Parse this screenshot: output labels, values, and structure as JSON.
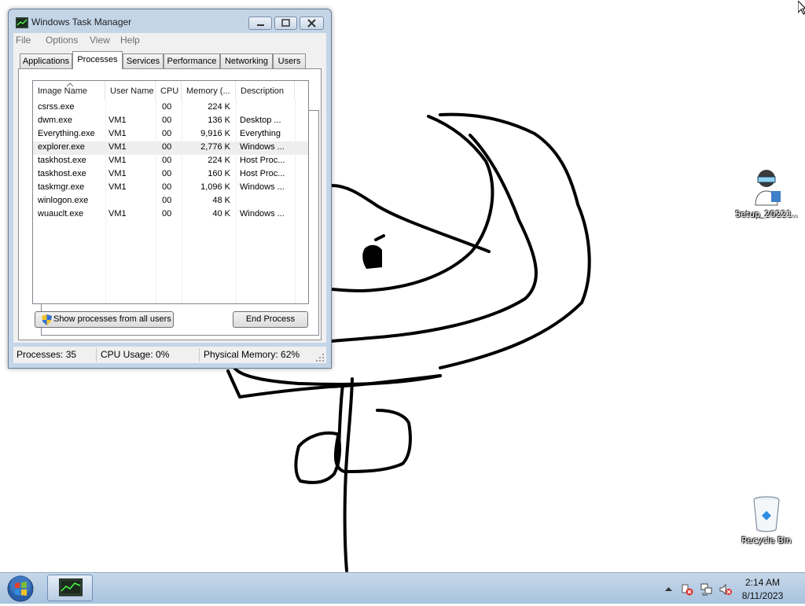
{
  "desktop": {
    "icons": [
      {
        "label": "Setup_20221..."
      },
      {
        "label": "Recycle Bin"
      }
    ]
  },
  "window": {
    "title": "Windows Task Manager",
    "menu": [
      "File",
      "Options",
      "View",
      "Help"
    ],
    "tabs": [
      "Applications",
      "Processes",
      "Services",
      "Performance",
      "Networking",
      "Users"
    ],
    "active_tab": "Processes",
    "columns": [
      "Image Name",
      "User Name",
      "CPU",
      "Memory (...",
      "Description"
    ],
    "rows": [
      {
        "image": "csrss.exe",
        "user": "",
        "cpu": "00",
        "memory": "224 K",
        "description": ""
      },
      {
        "image": "dwm.exe",
        "user": "VM1",
        "cpu": "00",
        "memory": "136 K",
        "description": "Desktop ..."
      },
      {
        "image": "Everything.exe",
        "user": "VM1",
        "cpu": "00",
        "memory": "9,916 K",
        "description": "Everything"
      },
      {
        "image": "explorer.exe",
        "user": "VM1",
        "cpu": "00",
        "memory": "2,776 K",
        "description": "Windows ..."
      },
      {
        "image": "taskhost.exe",
        "user": "VM1",
        "cpu": "00",
        "memory": "224 K",
        "description": "Host Proc..."
      },
      {
        "image": "taskhost.exe",
        "user": "VM1",
        "cpu": "00",
        "memory": "160 K",
        "description": "Host Proc..."
      },
      {
        "image": "taskmgr.exe",
        "user": "VM1",
        "cpu": "00",
        "memory": "1,096 K",
        "description": "Windows ..."
      },
      {
        "image": "winlogon.exe",
        "user": "",
        "cpu": "00",
        "memory": "48 K",
        "description": ""
      },
      {
        "image": "wuauclt.exe",
        "user": "VM1",
        "cpu": "00",
        "memory": "40 K",
        "description": "Windows ..."
      }
    ],
    "highlighted_row": 3,
    "show_all_button": "Show processes from all users",
    "end_process_button": "End Process",
    "status": {
      "processes": "Processes: 35",
      "cpu": "CPU Usage: 0%",
      "memory": "Physical Memory: 62%"
    }
  },
  "taskbar": {
    "time": "2:14 AM",
    "date": "8/11/2023"
  },
  "colors": {
    "taskbar": "#b3cae3",
    "window_frame": "#c4d5e8",
    "drawing_stroke": "#000000"
  }
}
